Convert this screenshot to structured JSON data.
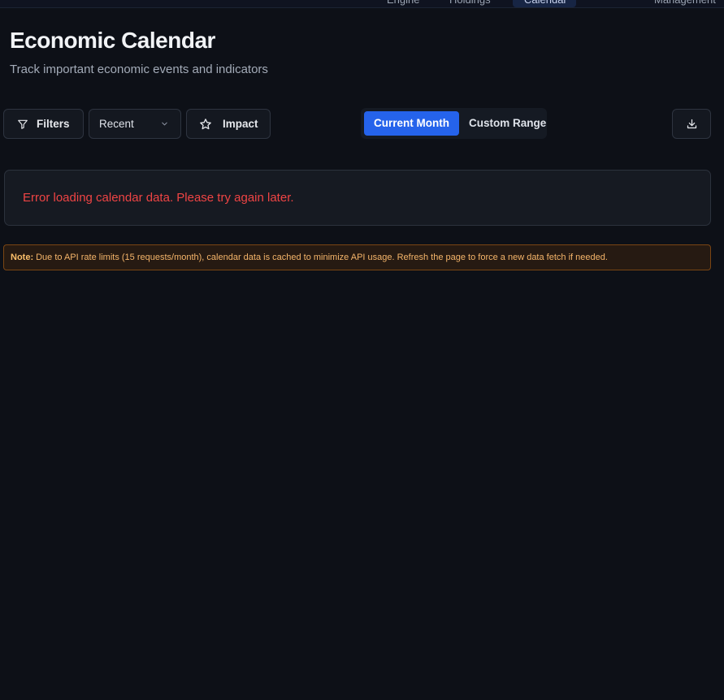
{
  "nav": {
    "items": [
      {
        "label": "Engine",
        "active": false
      },
      {
        "label": "Holdings",
        "active": false
      },
      {
        "label": "Calendar",
        "active": true
      },
      {
        "label": "Management",
        "active": false
      }
    ]
  },
  "header": {
    "title": "Economic Calendar",
    "subtitle": "Track important economic events and indicators"
  },
  "toolbar": {
    "filters_label": "Filters",
    "filters_icon": "filter-icon",
    "period_select": {
      "value": "Recent",
      "icon": "chevron-down-icon"
    },
    "impact_label": "Impact",
    "impact_icon": "star-icon",
    "range_tabs": [
      {
        "label": "Current Month",
        "active": true
      },
      {
        "label": "Custom Range",
        "active": false
      }
    ],
    "download_icon": "download-icon"
  },
  "error": {
    "message": "Error loading calendar data. Please try again later."
  },
  "note": {
    "label": "Note:",
    "text": "Due to API rate limits (15 requests/month), calendar data is cached to minimize API usage. Refresh the page to force a new data fetch if needed."
  },
  "colors": {
    "background": "#0d1017",
    "accent": "#2563eb",
    "error": "#ef4444",
    "note_text": "#f5b56a",
    "note_border": "#7a4513"
  }
}
